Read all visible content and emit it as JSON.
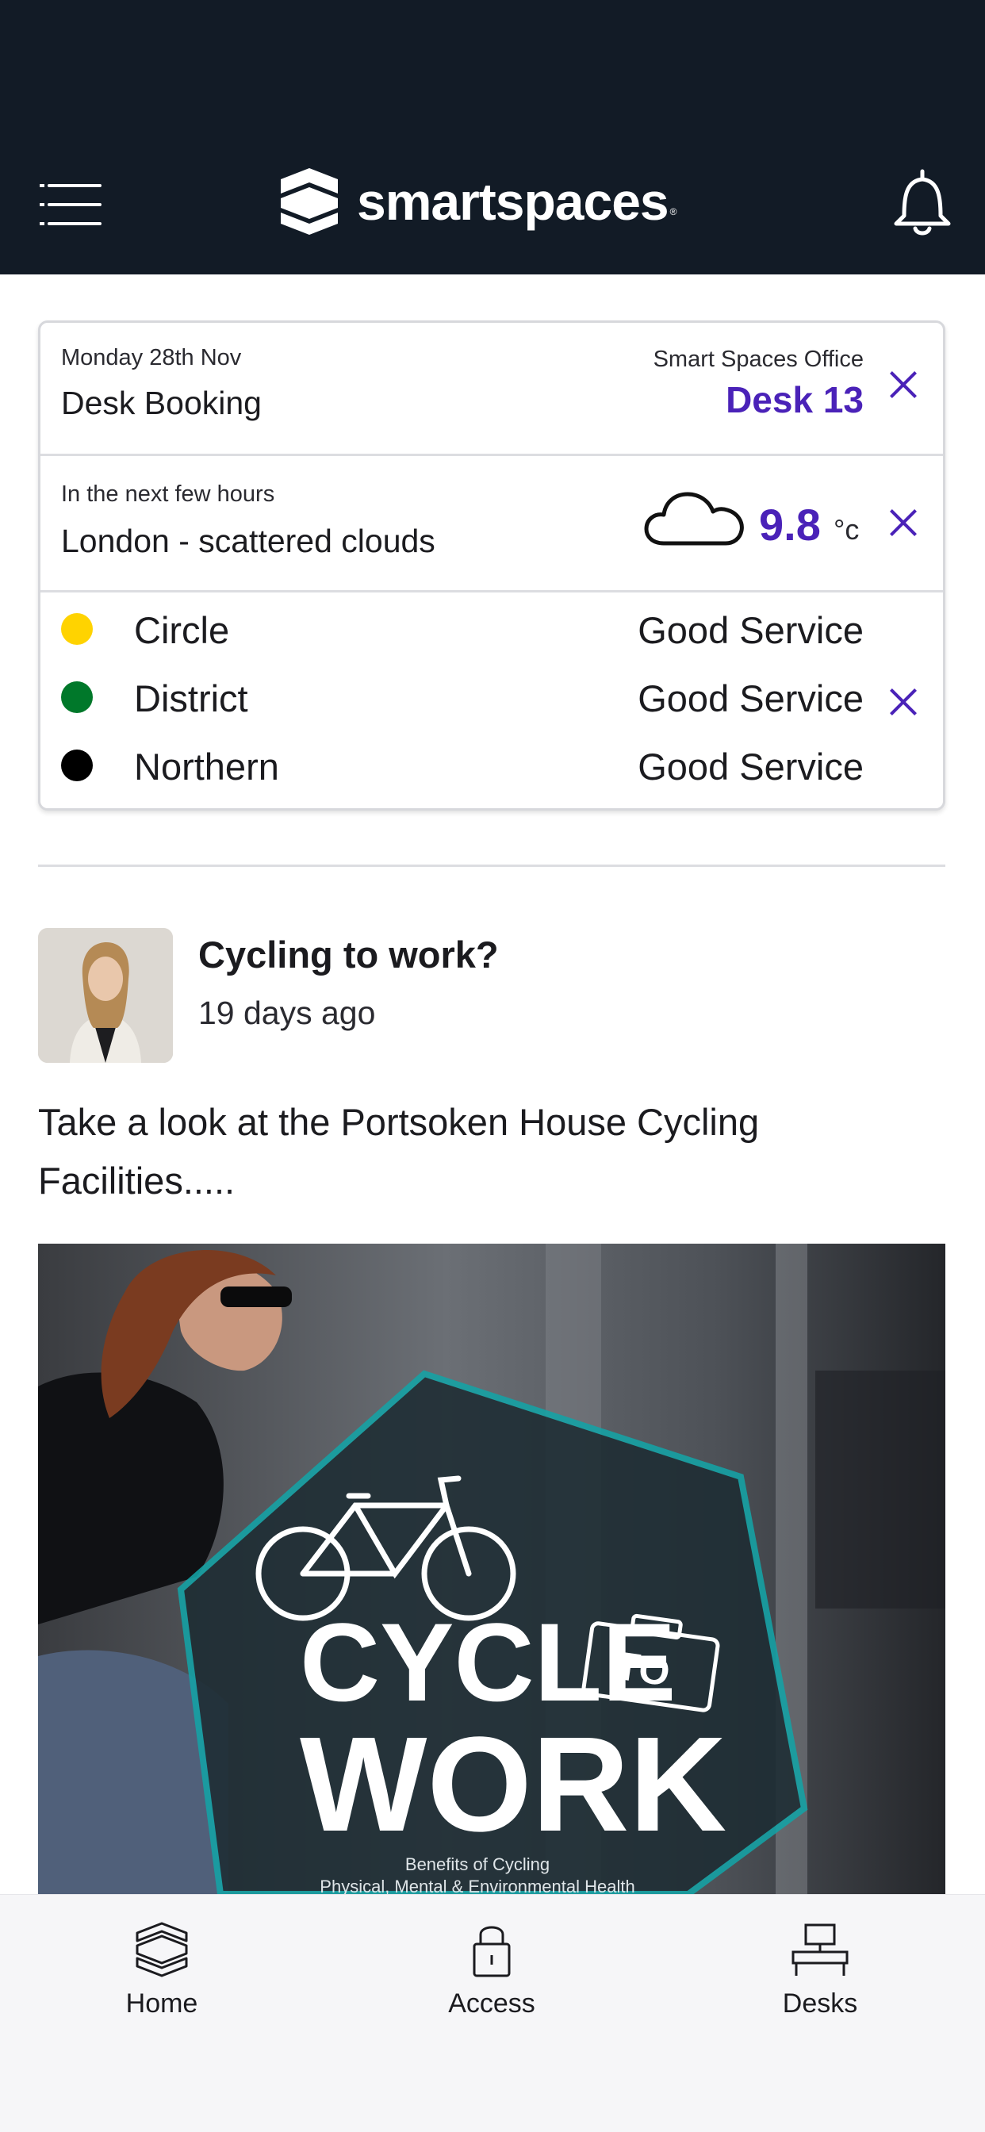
{
  "header": {
    "brand_name": "smartspaces",
    "registered_mark": "®",
    "menu_icon": "hamburger-menu-icon",
    "notification_icon": "bell-icon"
  },
  "booking": {
    "date": "Monday 28th Nov",
    "type": "Desk Booking",
    "location": "Smart Spaces Office",
    "desk": "Desk 13"
  },
  "weather": {
    "subtitle": "In the next few hours",
    "summary": "London - scattered clouds",
    "temperature": "9.8",
    "unit": "°c",
    "icon": "cloud-icon"
  },
  "tube": {
    "lines": [
      {
        "name": "Circle",
        "status": "Good Service",
        "color": "#ffd300"
      },
      {
        "name": "District",
        "status": "Good Service",
        "color": "#00782a"
      },
      {
        "name": "Northern",
        "status": "Good Service",
        "color": "#000000"
      }
    ]
  },
  "post": {
    "title": "Cycling to work?",
    "time_ago": "19 days ago",
    "body": "Take a look at the Portsoken House Cycling Facilities.....",
    "image": {
      "headline_1": "CYCLE",
      "badge": "TO",
      "headline_2": "WORK",
      "caption_1": "Benefits of Cycling",
      "caption_2": "Physical, Mental & Environmental Health"
    }
  },
  "nav": {
    "items": [
      {
        "label": "Home",
        "icon": "home-layers-icon"
      },
      {
        "label": "Access",
        "icon": "padlock-icon"
      },
      {
        "label": "Desks",
        "icon": "desk-icon"
      }
    ]
  },
  "colors": {
    "header_bg": "#121b26",
    "accent": "#4a22b8",
    "teal": "#14a3a6"
  }
}
